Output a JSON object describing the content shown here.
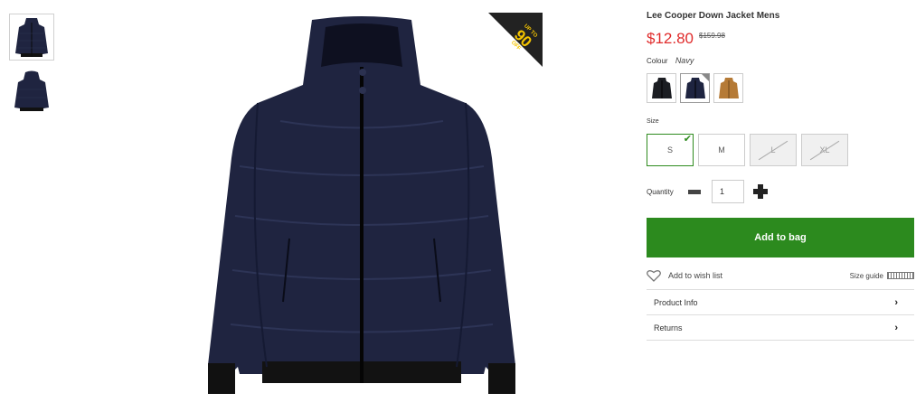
{
  "product": {
    "title": "Lee Cooper Down Jacket Mens",
    "price": "$12.80",
    "was_price": "$159.98"
  },
  "promo": {
    "small": "UP TO",
    "big": "90",
    "off": "OFF"
  },
  "colour": {
    "label": "Colour",
    "value": "Navy",
    "swatches": [
      {
        "name": "black",
        "color": "#1b1d22"
      },
      {
        "name": "navy",
        "color": "#1e2440"
      },
      {
        "name": "tan",
        "color": "#b57a36"
      }
    ]
  },
  "size": {
    "label": "Size",
    "options": [
      "S",
      "M",
      "L",
      "XL"
    ]
  },
  "quantity": {
    "label": "Quantity",
    "value": "1"
  },
  "actions": {
    "add_to_bag": "Add to bag",
    "wish_list": "Add to wish list",
    "size_guide": "Size guide"
  },
  "accordion": [
    "Product Info",
    "Returns"
  ],
  "colors": {
    "accent_green": "#2c8a1e",
    "price_red": "#e02b2b",
    "jacket": "#1f2440"
  }
}
